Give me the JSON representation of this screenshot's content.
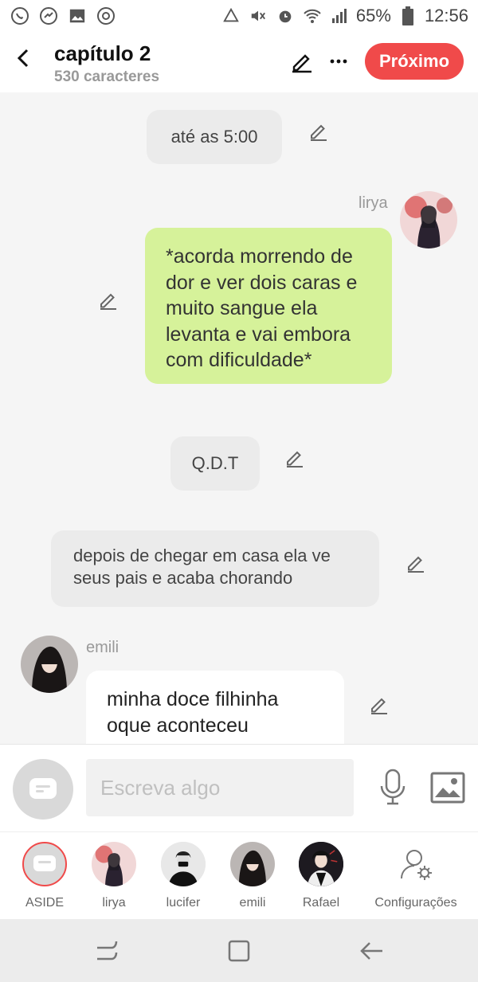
{
  "status_bar": {
    "battery": "65%",
    "time": "12:56",
    "left_icons": [
      "whatsapp-icon",
      "messenger-icon",
      "gallery-icon",
      "chrome-icon"
    ],
    "right_icons": [
      "data-saver-icon",
      "mute-icon",
      "alarm-icon",
      "wifi-icon",
      "signal-icon",
      "battery-icon"
    ]
  },
  "header": {
    "title": "capítulo 2",
    "subtitle": "530 caracteres",
    "next_label": "Próximo",
    "accent_color": "#f04a4a"
  },
  "messages": [
    {
      "type": "narration",
      "text": "até as 5:00"
    },
    {
      "type": "character",
      "name": "lirya",
      "text": "*acorda morrendo de dor e ver dois caras e muito sangue ela levanta e vai embora com dificuldade*",
      "bubble_color": "#d6f29a"
    },
    {
      "type": "narration",
      "text": "Q.D.T"
    },
    {
      "type": "narration",
      "text": "depois de chegar em casa ela ve seus pais e acaba chorando"
    },
    {
      "type": "character",
      "name": "emili",
      "text": "minha doce filhinha oque aconteceu",
      "bubble_color": "#ffffff"
    }
  ],
  "input": {
    "placeholder": "Escreva algo"
  },
  "characters": [
    {
      "label": "ASIDE"
    },
    {
      "label": "lirya"
    },
    {
      "label": "lucifer"
    },
    {
      "label": "emili"
    },
    {
      "label": "Rafael"
    },
    {
      "label": "Configurações"
    }
  ]
}
